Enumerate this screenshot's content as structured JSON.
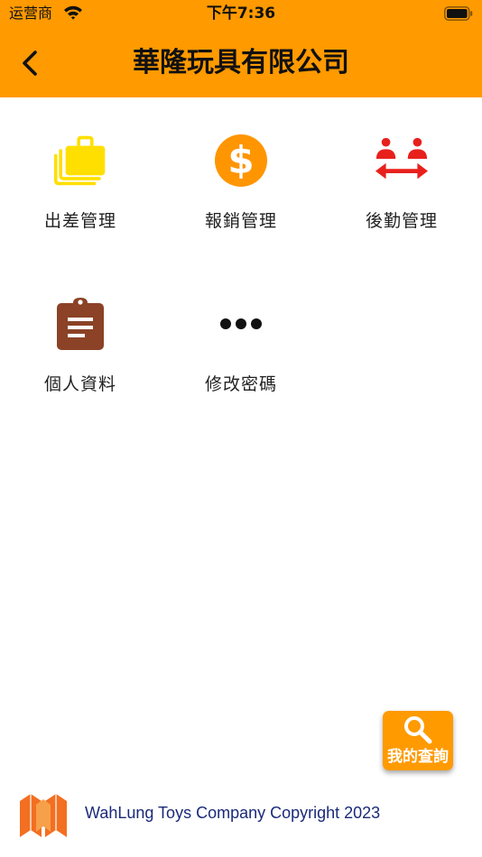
{
  "status_bar": {
    "carrier": "运营商",
    "time": "下午7:36",
    "icons": [
      "wifi-icon",
      "battery-icon"
    ]
  },
  "header": {
    "back_icon": "chevron-left-icon",
    "title": "華隆玩具有限公司",
    "color": "#ff9a00"
  },
  "menu": {
    "items": [
      {
        "label": "出差管理",
        "icon": "briefcase-stack-icon",
        "color": "#ffdf00"
      },
      {
        "label": "報銷管理",
        "icon": "dollar-coin-icon",
        "color": "#ff9500"
      },
      {
        "label": "後勤管理",
        "icon": "people-exchange-icon",
        "color": "#e8201c"
      },
      {
        "label": "個人資料",
        "icon": "clipboard-icon",
        "color": "#8b4226"
      },
      {
        "label": "修改密碼",
        "icon": "more-dots-icon",
        "color": "#111111"
      }
    ]
  },
  "fab": {
    "icon": "search-icon",
    "label": "我的查詢"
  },
  "footer": {
    "logo": "wahlung-logo",
    "copyright": "WahLung Toys Company Copyright 2023",
    "text_color": "#1a2a7a",
    "logo_color": "#f36f21"
  }
}
